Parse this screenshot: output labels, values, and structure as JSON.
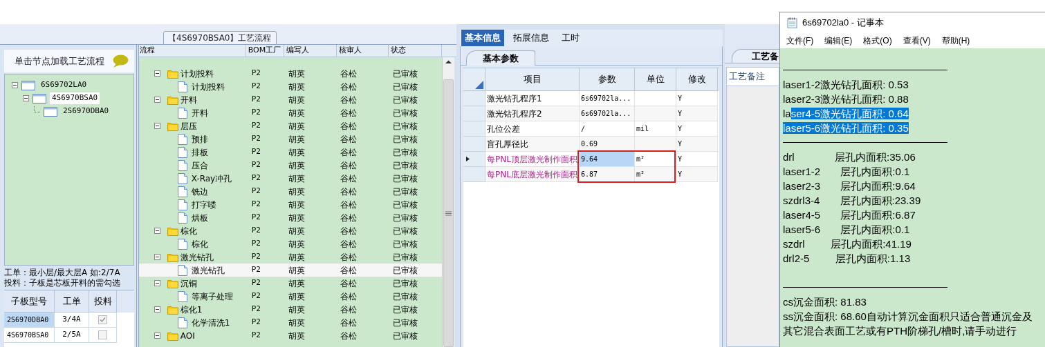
{
  "process_title": "【4S6970BSA0】工艺流程",
  "left_panel": {
    "hint": "单击节点加载工艺流程",
    "tree": [
      {
        "label": "6S69702LA0",
        "expanded": true,
        "selected": false,
        "children": [
          {
            "label": "4S6970BSA0",
            "expanded": true,
            "selected": true,
            "children": [
              {
                "label": "2S6970DBA0",
                "selected": false
              }
            ]
          }
        ]
      }
    ],
    "notes": [
      "工单：最小层/最大层A 如:2/7A",
      "投料：子板是芯板开料的需勾选"
    ],
    "board_table": {
      "columns": [
        "子板型号",
        "工单",
        "投料"
      ],
      "rows": [
        {
          "board": "2S6970DBA0",
          "order": "3/4A",
          "feed": true,
          "selected": true
        },
        {
          "board": "4S6970BSA0",
          "order": "2/5A",
          "feed": false,
          "selected": false
        }
      ]
    }
  },
  "process_grid": {
    "columns": [
      "流程",
      "BOM工厂",
      "编写人",
      "核审人",
      "状态"
    ],
    "rows": [
      {
        "kind": "folder",
        "label": "计划投料",
        "bom": "P2",
        "writer": "胡英",
        "reviewer": "谷松",
        "status": "已审核",
        "selected": false,
        "expanded": true,
        "children": [
          {
            "kind": "file",
            "label": "计划投料",
            "bom": "P2",
            "writer": "胡英",
            "reviewer": "谷松",
            "status": "已审核",
            "selected": false
          }
        ]
      },
      {
        "kind": "folder",
        "label": "开料",
        "bom": "P2",
        "writer": "胡英",
        "reviewer": "谷松",
        "status": "已审核",
        "selected": false,
        "expanded": true,
        "children": [
          {
            "kind": "file",
            "label": "开料",
            "bom": "P2",
            "writer": "胡英",
            "reviewer": "谷松",
            "status": "已审核",
            "selected": false
          }
        ]
      },
      {
        "kind": "folder",
        "label": "层压",
        "bom": "P2",
        "writer": "胡英",
        "reviewer": "谷松",
        "status": "已审核",
        "selected": false,
        "expanded": true,
        "children": [
          {
            "kind": "file",
            "label": "预排",
            "bom": "P2",
            "writer": "胡英",
            "reviewer": "谷松",
            "status": "已审核",
            "selected": false
          },
          {
            "kind": "file",
            "label": "排板",
            "bom": "P2",
            "writer": "胡英",
            "reviewer": "谷松",
            "status": "已审核",
            "selected": false
          },
          {
            "kind": "file",
            "label": "压合",
            "bom": "P2",
            "writer": "胡英",
            "reviewer": "谷松",
            "status": "已审核",
            "selected": false
          },
          {
            "kind": "file",
            "label": "X-Ray冲孔",
            "bom": "P2",
            "writer": "胡英",
            "reviewer": "谷松",
            "status": "已审核",
            "selected": false
          },
          {
            "kind": "file",
            "label": "铣边",
            "bom": "P2",
            "writer": "胡英",
            "reviewer": "谷松",
            "status": "已审核",
            "selected": false
          },
          {
            "kind": "file",
            "label": "打字喽",
            "bom": "P2",
            "writer": "胡英",
            "reviewer": "谷松",
            "status": "已审核",
            "selected": false
          },
          {
            "kind": "file",
            "label": "烘板",
            "bom": "P2",
            "writer": "胡英",
            "reviewer": "谷松",
            "status": "已审核",
            "selected": false
          }
        ]
      },
      {
        "kind": "folder",
        "label": "棕化",
        "bom": "P2",
        "writer": "胡英",
        "reviewer": "谷松",
        "status": "已审核",
        "selected": false,
        "expanded": true,
        "children": [
          {
            "kind": "file",
            "label": "棕化",
            "bom": "P2",
            "writer": "胡英",
            "reviewer": "谷松",
            "status": "已审核",
            "selected": false
          }
        ]
      },
      {
        "kind": "folder",
        "label": "激光钻孔",
        "bom": "P2",
        "writer": "胡英",
        "reviewer": "谷松",
        "status": "已审核",
        "selected": false,
        "expanded": true,
        "children": [
          {
            "kind": "file",
            "label": "激光钻孔",
            "bom": "P2",
            "writer": "胡英",
            "reviewer": "谷松",
            "status": "已审核",
            "selected": true
          }
        ]
      },
      {
        "kind": "folder",
        "label": "沉铜",
        "bom": "P2",
        "writer": "胡英",
        "reviewer": "谷松",
        "status": "已审核",
        "selected": false,
        "expanded": true,
        "children": [
          {
            "kind": "file",
            "label": "等离子处理",
            "bom": "P2",
            "writer": "胡英",
            "reviewer": "谷松",
            "status": "已审核",
            "selected": false
          }
        ]
      },
      {
        "kind": "folder",
        "label": "棕化1",
        "bom": "P2",
        "writer": "胡英",
        "reviewer": "谷松",
        "status": "已审核",
        "selected": false,
        "expanded": true,
        "children": [
          {
            "kind": "file",
            "label": "化学清洗1",
            "bom": "P2",
            "writer": "胡英",
            "reviewer": "谷松",
            "status": "已审核",
            "selected": false
          }
        ]
      },
      {
        "kind": "folder",
        "label": "AOI",
        "bom": "P2",
        "writer": "胡英",
        "reviewer": "谷松",
        "status": "已审核",
        "selected": false,
        "expanded": true
      }
    ]
  },
  "detail": {
    "tabs": [
      {
        "label": "基本信息",
        "selected": true
      },
      {
        "label": "拓展信息",
        "selected": false
      },
      {
        "label": "工时",
        "selected": false
      }
    ],
    "subtab": "基本参数",
    "grid": {
      "columns": [
        "项目",
        "参数",
        "单位",
        "修改"
      ],
      "rows": [
        {
          "item": "激光钻孔程序1",
          "value": "6s69702la...",
          "unit": "",
          "editable": "Y",
          "current": false,
          "highlight": false,
          "boxed": false
        },
        {
          "item": "激光钻孔程序2",
          "value": "6s69702la...",
          "unit": "",
          "editable": "Y",
          "current": false,
          "highlight": false,
          "boxed": false
        },
        {
          "item": "孔位公差",
          "value": "/",
          "unit": "mil",
          "editable": "Y",
          "current": false,
          "highlight": false,
          "boxed": false
        },
        {
          "item": "盲孔厚径比",
          "value": "0.69",
          "unit": "",
          "editable": "Y",
          "current": false,
          "highlight": false,
          "boxed": false
        },
        {
          "item": "每PNL顶层激光制作面积",
          "value": "9.64",
          "unit": "m²",
          "editable": "Y",
          "current": true,
          "highlight": true,
          "boxed": true
        },
        {
          "item": "每PNL底层激光制作面积",
          "value": "6.87",
          "unit": "m²",
          "editable": "Y",
          "current": false,
          "highlight": true,
          "boxed": true
        }
      ]
    }
  },
  "remarks": {
    "tab": "工艺备",
    "label": "工艺备注"
  },
  "notepad": {
    "title": "6s69702la0 - 记事本",
    "menu": [
      "文件(F)",
      "编辑(E)",
      "格式(O)",
      "查看(V)",
      "帮助(H)"
    ],
    "lines": [
      {
        "kind": "blank"
      },
      {
        "kind": "rule"
      },
      {
        "kind": "text",
        "segments": [
          {
            "text": "laser1-2激光钻孔面积: 0.53",
            "selected": false
          }
        ]
      },
      {
        "kind": "text",
        "segments": [
          {
            "text": "laser2-3激光钻孔面积: 0.88",
            "selected": false
          }
        ]
      },
      {
        "kind": "text",
        "segments": [
          {
            "text": "la",
            "selected": false
          },
          {
            "text": "ser4-5激光钻孔面积: 0.64",
            "selected": true
          }
        ]
      },
      {
        "kind": "text",
        "segments": [
          {
            "text": "laser5-6激光钻孔面积: 0.35",
            "selected": true
          }
        ]
      },
      {
        "kind": "rule"
      },
      {
        "kind": "text",
        "segments": [
          {
            "text": "drl              层孔内面积:35.06",
            "selected": false
          }
        ]
      },
      {
        "kind": "text",
        "segments": [
          {
            "text": "laser1-2       层孔内面积:0.1",
            "selected": false
          }
        ]
      },
      {
        "kind": "text",
        "segments": [
          {
            "text": "laser2-3       层孔内面积:9.64",
            "selected": false
          }
        ]
      },
      {
        "kind": "text",
        "segments": [
          {
            "text": "szdrl3-4       层孔内面积:23.39",
            "selected": false
          }
        ]
      },
      {
        "kind": "text",
        "segments": [
          {
            "text": "laser4-5       层孔内面积:6.87",
            "selected": false
          }
        ]
      },
      {
        "kind": "text",
        "segments": [
          {
            "text": "laser5-6       层孔内面积:0.1",
            "selected": false
          }
        ]
      },
      {
        "kind": "text",
        "segments": [
          {
            "text": "szdrl         层孔内面积:41.19",
            "selected": false
          }
        ]
      },
      {
        "kind": "text",
        "segments": [
          {
            "text": "drl2-5         层孔内面积:1.13",
            "selected": false
          }
        ]
      },
      {
        "kind": "blank"
      },
      {
        "kind": "rule"
      },
      {
        "kind": "text",
        "segments": [
          {
            "text": "cs沉金面积: 81.83",
            "selected": false
          }
        ]
      },
      {
        "kind": "text",
        "segments": [
          {
            "text": "ss沉金面积: 68.60自动计算沉金面积只适合普通沉金及",
            "selected": false
          }
        ]
      },
      {
        "kind": "text",
        "segments": [
          {
            "text": "其它混合表面工艺或有PTH阶梯孔/槽时,请手动进行",
            "selected": false
          }
        ]
      }
    ]
  }
}
